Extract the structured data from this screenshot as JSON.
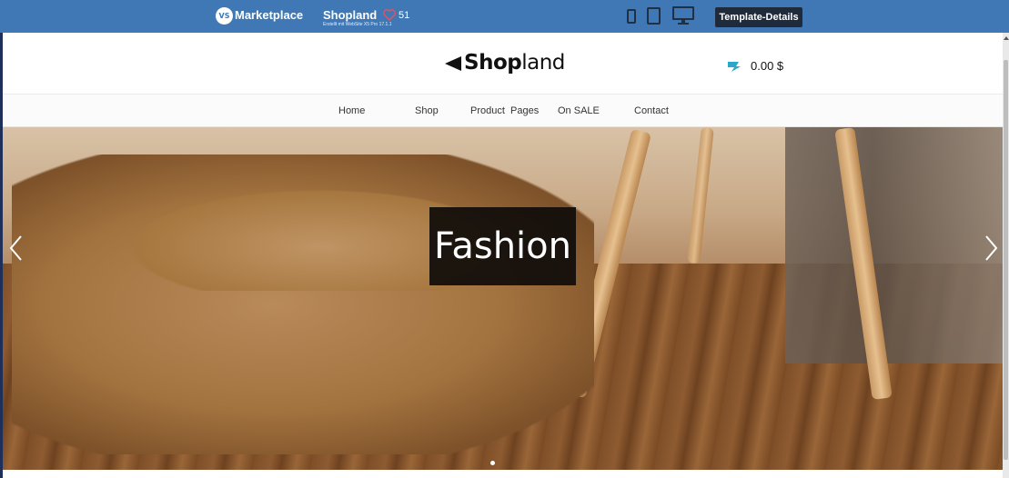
{
  "topbar": {
    "marketplace_logo": "VS",
    "marketplace_label": "Marketplace",
    "template_name": "Shopland",
    "template_subtitle": "Erstellt mit WebSite X5 Pro 17.1.1",
    "like_count": "51",
    "details_button": "Template-Details",
    "bar_color": "#3f78b4"
  },
  "header": {
    "brand_bold": "Shop",
    "brand_light": "land",
    "cart_total": "0.00 $",
    "cart_icon": "cart-icon",
    "cart_icon_color": "#2aa8c9"
  },
  "nav": {
    "items": [
      {
        "label": "Home"
      },
      {
        "label": "Shop"
      },
      {
        "label": "Product  Pages"
      },
      {
        "label": "On SALE"
      },
      {
        "label": "Contact"
      }
    ]
  },
  "hero": {
    "caption": "Fashion",
    "slide_count": 1,
    "active_slide": 1
  }
}
